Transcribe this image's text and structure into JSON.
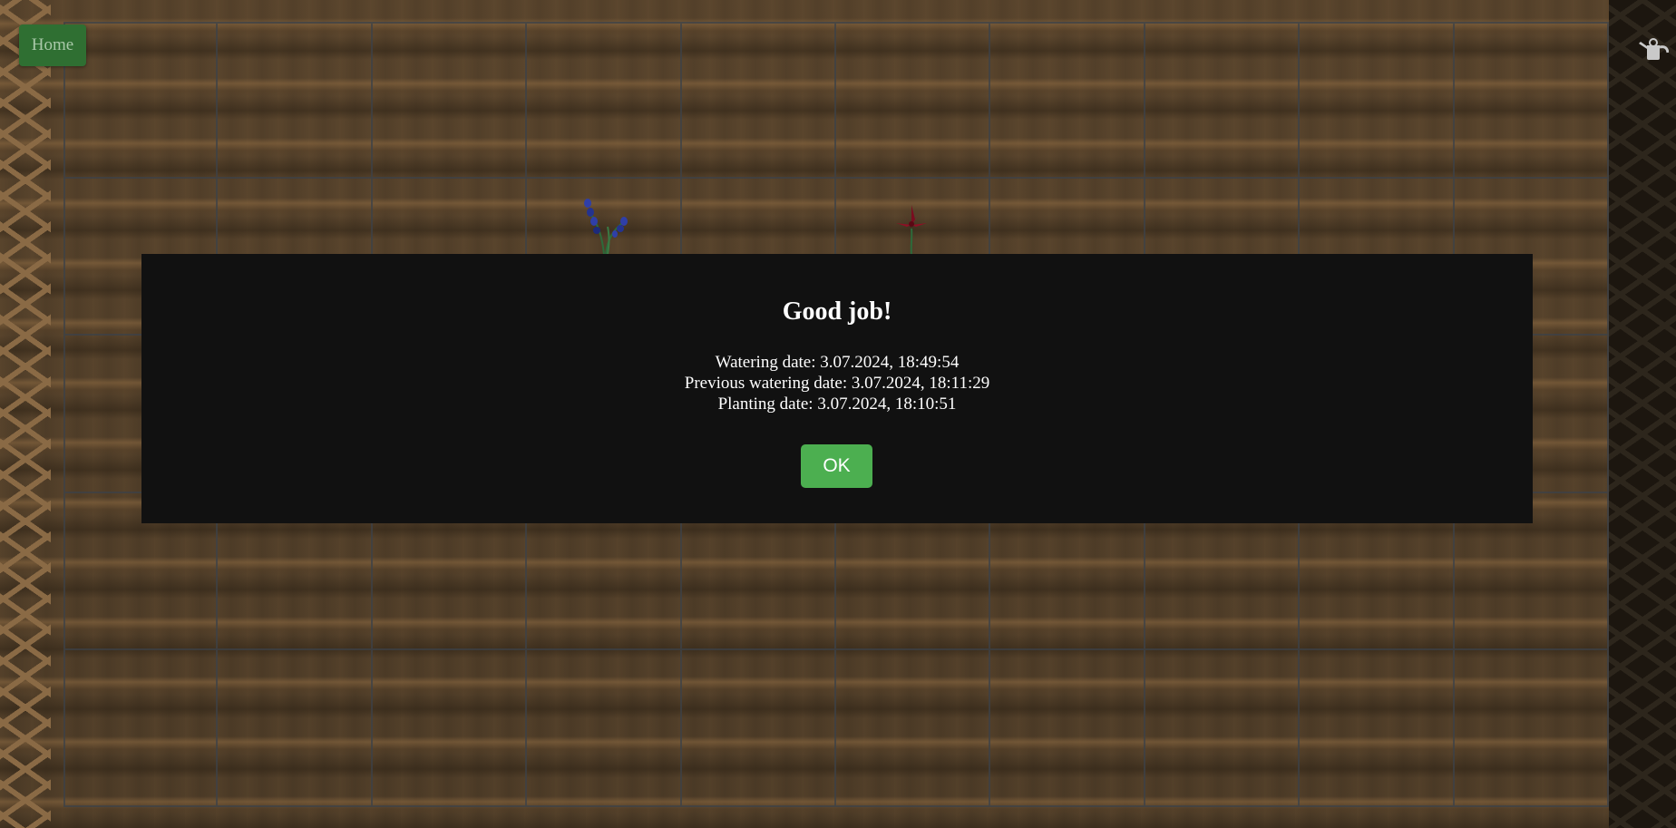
{
  "nav": {
    "home_label": "Home"
  },
  "tools": {
    "watering_can_icon": "watering-can-icon"
  },
  "garden": {
    "rows": 5,
    "columns": 10,
    "plants": [
      {
        "row": 1,
        "col": 3,
        "type": "bluebell",
        "color": "#2f3fa8"
      },
      {
        "row": 1,
        "col": 5,
        "type": "red-lily",
        "color": "#8e1025"
      }
    ]
  },
  "dialog": {
    "title": "Good job!",
    "lines": [
      "Watering date: 3.07.2024, 18:49:54",
      "Previous watering date: 3.07.2024, 18:11:29",
      "Planting date: 3.07.2024, 18:10:51"
    ],
    "ok_label": "OK"
  },
  "colors": {
    "modal_bg": "#111111",
    "ok_button": "#4caf50",
    "home_button": "#2f6f32"
  }
}
